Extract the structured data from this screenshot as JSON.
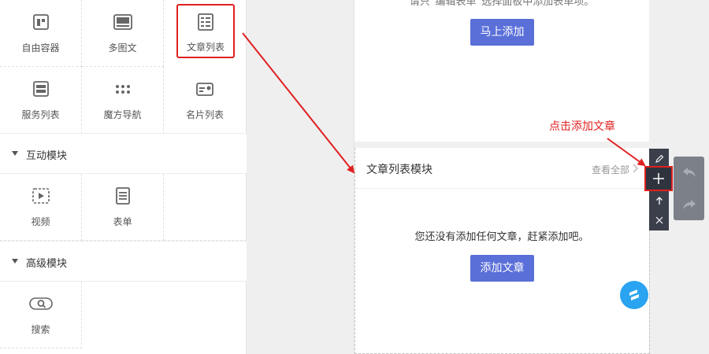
{
  "left_panel": {
    "grid1": [
      {
        "label": "自由容器",
        "icon": "free-container-icon"
      },
      {
        "label": "多图文",
        "icon": "multi-image-text-icon"
      },
      {
        "label": "文章列表",
        "icon": "article-list-icon",
        "highlighted": true
      },
      {
        "label": "服务列表",
        "icon": "service-list-icon"
      },
      {
        "label": "魔方导航",
        "icon": "magic-cube-nav-icon"
      },
      {
        "label": "名片列表",
        "icon": "business-card-list-icon"
      }
    ],
    "section_interactive": "互动模块",
    "grid2": [
      {
        "label": "视频",
        "icon": "video-icon"
      },
      {
        "label": "表单",
        "icon": "form-icon"
      }
    ],
    "section_advanced": "高级模块",
    "grid3": [
      {
        "label": "搜索",
        "icon": "search-icon"
      }
    ]
  },
  "preview": {
    "top_hint": "请只“编辑表单”选择面板中添加表单项。",
    "add_now_button": "马上添加",
    "module_title": "文章列表模块",
    "view_all": "查看全部",
    "empty_message": "您还没有添加任何文章，赶紧添加吧。",
    "add_article_button": "添加文章"
  },
  "annotation": "点击添加文章",
  "colors": {
    "accent": "#5a6fd8",
    "annotation_red": "#e02020",
    "toolbar_dark": "#3a3f4b"
  }
}
